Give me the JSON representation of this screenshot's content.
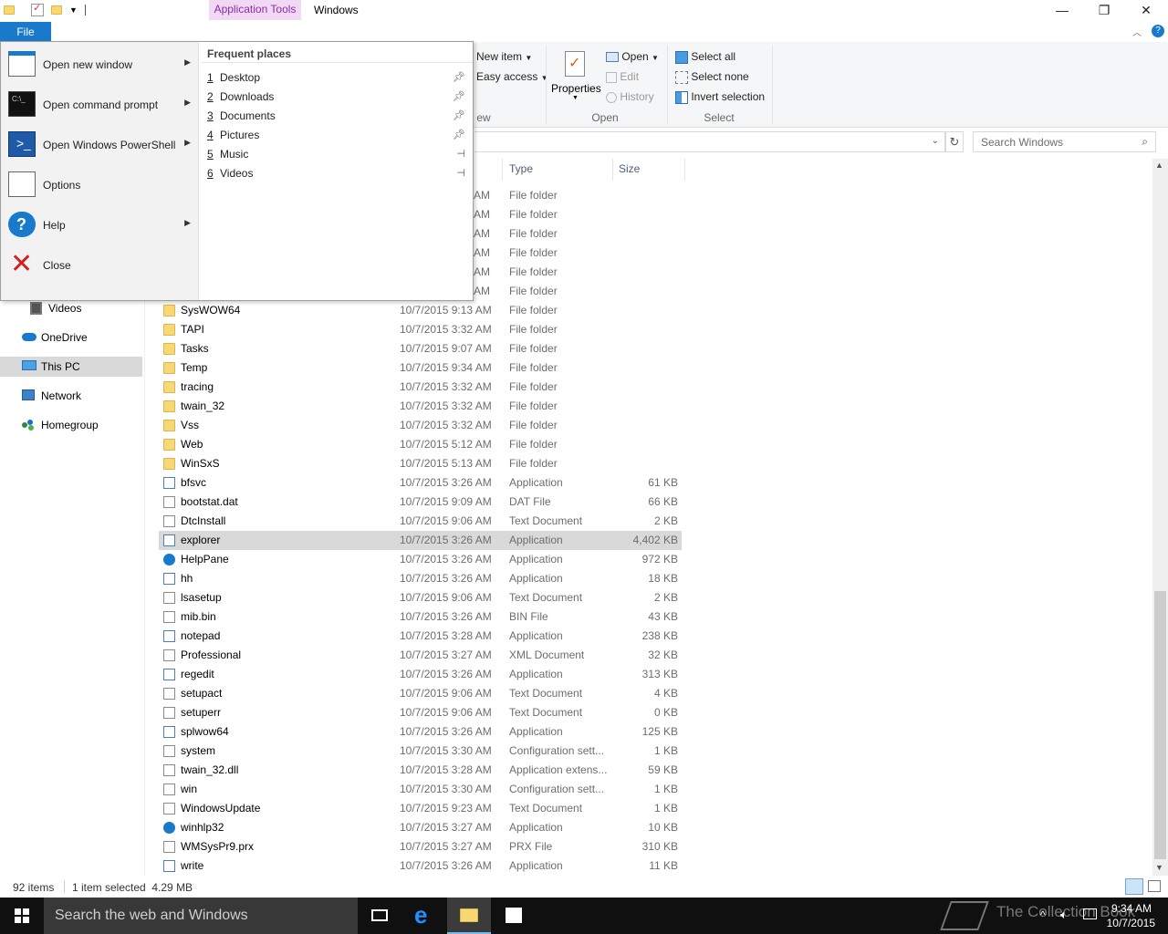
{
  "titlebar": {
    "context_tab": "Application Tools",
    "title": "Windows",
    "minimize": "—",
    "restore": "❐",
    "close": "✕"
  },
  "tabs": {
    "file": "File"
  },
  "ribbon": {
    "new_item": "New item",
    "easy_access": "Easy access",
    "new_group_partial": "ew",
    "properties": "Properties",
    "open": "Open",
    "edit": "Edit",
    "history": "History",
    "open_group": "Open",
    "select_all": "Select all",
    "select_none": "Select none",
    "invert_selection": "Invert selection",
    "select_group": "Select"
  },
  "search": {
    "placeholder": "Search Windows"
  },
  "columns": {
    "type": "Type",
    "size": "Size"
  },
  "file_menu": {
    "commands": [
      {
        "label": "Open new window",
        "arrow": "▶"
      },
      {
        "label": "Open command prompt",
        "arrow": "▶"
      },
      {
        "label": "Open Windows PowerShell",
        "arrow": "▶"
      },
      {
        "label": "Options",
        "arrow": ""
      },
      {
        "label": "Help",
        "arrow": "▶"
      },
      {
        "label": "Close",
        "arrow": ""
      }
    ],
    "frequent_title": "Frequent places",
    "frequent": [
      {
        "num": "1",
        "label": "Desktop"
      },
      {
        "num": "2",
        "label": "Downloads"
      },
      {
        "num": "3",
        "label": "Documents"
      },
      {
        "num": "4",
        "label": "Pictures"
      },
      {
        "num": "5",
        "label": "Music"
      },
      {
        "num": "6",
        "label": "Videos"
      }
    ]
  },
  "partial_rows": [
    {
      "date": "AM",
      "type": "File folder"
    },
    {
      "date": "AM",
      "type": "File folder"
    },
    {
      "date": "AM",
      "type": "File folder"
    },
    {
      "date": "AM",
      "type": "File folder"
    },
    {
      "date": "AM",
      "type": "File folder"
    },
    {
      "date": "AM",
      "type": "File folder"
    }
  ],
  "nav": {
    "videos": "Videos",
    "onedrive": "OneDrive",
    "thispc": "This PC",
    "network": "Network",
    "homegroup": "Homegroup"
  },
  "files": [
    {
      "name": "SysWOW64",
      "date": "10/7/2015 9:13 AM",
      "type": "File folder",
      "size": "",
      "icon": "folder"
    },
    {
      "name": "TAPI",
      "date": "10/7/2015 3:32 AM",
      "type": "File folder",
      "size": "",
      "icon": "folder"
    },
    {
      "name": "Tasks",
      "date": "10/7/2015 9:07 AM",
      "type": "File folder",
      "size": "",
      "icon": "folder"
    },
    {
      "name": "Temp",
      "date": "10/7/2015 9:34 AM",
      "type": "File folder",
      "size": "",
      "icon": "folder"
    },
    {
      "name": "tracing",
      "date": "10/7/2015 3:32 AM",
      "type": "File folder",
      "size": "",
      "icon": "folder"
    },
    {
      "name": "twain_32",
      "date": "10/7/2015 3:32 AM",
      "type": "File folder",
      "size": "",
      "icon": "folder"
    },
    {
      "name": "Vss",
      "date": "10/7/2015 3:32 AM",
      "type": "File folder",
      "size": "",
      "icon": "folder"
    },
    {
      "name": "Web",
      "date": "10/7/2015 5:12 AM",
      "type": "File folder",
      "size": "",
      "icon": "folder"
    },
    {
      "name": "WinSxS",
      "date": "10/7/2015 5:13 AM",
      "type": "File folder",
      "size": "",
      "icon": "folder"
    },
    {
      "name": "bfsvc",
      "date": "10/7/2015 3:26 AM",
      "type": "Application",
      "size": "61 KB",
      "icon": "app"
    },
    {
      "name": "bootstat.dat",
      "date": "10/7/2015 9:09 AM",
      "type": "DAT File",
      "size": "66 KB",
      "icon": "doc"
    },
    {
      "name": "DtcInstall",
      "date": "10/7/2015 9:06 AM",
      "type": "Text Document",
      "size": "2 KB",
      "icon": "doc"
    },
    {
      "name": "explorer",
      "date": "10/7/2015 3:26 AM",
      "type": "Application",
      "size": "4,402 KB",
      "icon": "app",
      "selected": true
    },
    {
      "name": "HelpPane",
      "date": "10/7/2015 3:26 AM",
      "type": "Application",
      "size": "972 KB",
      "icon": "help"
    },
    {
      "name": "hh",
      "date": "10/7/2015 3:26 AM",
      "type": "Application",
      "size": "18 KB",
      "icon": "app"
    },
    {
      "name": "lsasetup",
      "date": "10/7/2015 9:06 AM",
      "type": "Text Document",
      "size": "2 KB",
      "icon": "doc"
    },
    {
      "name": "mib.bin",
      "date": "10/7/2015 3:26 AM",
      "type": "BIN File",
      "size": "43 KB",
      "icon": "doc"
    },
    {
      "name": "notepad",
      "date": "10/7/2015 3:28 AM",
      "type": "Application",
      "size": "238 KB",
      "icon": "app"
    },
    {
      "name": "Professional",
      "date": "10/7/2015 3:27 AM",
      "type": "XML Document",
      "size": "32 KB",
      "icon": "doc"
    },
    {
      "name": "regedit",
      "date": "10/7/2015 3:26 AM",
      "type": "Application",
      "size": "313 KB",
      "icon": "app"
    },
    {
      "name": "setupact",
      "date": "10/7/2015 9:06 AM",
      "type": "Text Document",
      "size": "4 KB",
      "icon": "doc"
    },
    {
      "name": "setuperr",
      "date": "10/7/2015 9:06 AM",
      "type": "Text Document",
      "size": "0 KB",
      "icon": "doc"
    },
    {
      "name": "splwow64",
      "date": "10/7/2015 3:26 AM",
      "type": "Application",
      "size": "125 KB",
      "icon": "app"
    },
    {
      "name": "system",
      "date": "10/7/2015 3:30 AM",
      "type": "Configuration sett...",
      "size": "1 KB",
      "icon": "doc"
    },
    {
      "name": "twain_32.dll",
      "date": "10/7/2015 3:28 AM",
      "type": "Application extens...",
      "size": "59 KB",
      "icon": "doc"
    },
    {
      "name": "win",
      "date": "10/7/2015 3:30 AM",
      "type": "Configuration sett...",
      "size": "1 KB",
      "icon": "doc"
    },
    {
      "name": "WindowsUpdate",
      "date": "10/7/2015 9:23 AM",
      "type": "Text Document",
      "size": "1 KB",
      "icon": "doc"
    },
    {
      "name": "winhlp32",
      "date": "10/7/2015 3:27 AM",
      "type": "Application",
      "size": "10 KB",
      "icon": "help"
    },
    {
      "name": "WMSysPr9.prx",
      "date": "10/7/2015 3:27 AM",
      "type": "PRX File",
      "size": "310 KB",
      "icon": "doc"
    },
    {
      "name": "write",
      "date": "10/7/2015 3:26 AM",
      "type": "Application",
      "size": "11 KB",
      "icon": "app"
    }
  ],
  "status": {
    "items": "92 items",
    "selected": "1 item selected  4.29 MB"
  },
  "taskbar": {
    "search": "Search the web and Windows",
    "time": "9:34 AM",
    "date": "10/7/2015",
    "watermark": "The Collection Book"
  },
  "colors": {
    "accent": "#1979ca",
    "context_tab": "#f1d9f5",
    "selection": "#d9d9d9"
  }
}
